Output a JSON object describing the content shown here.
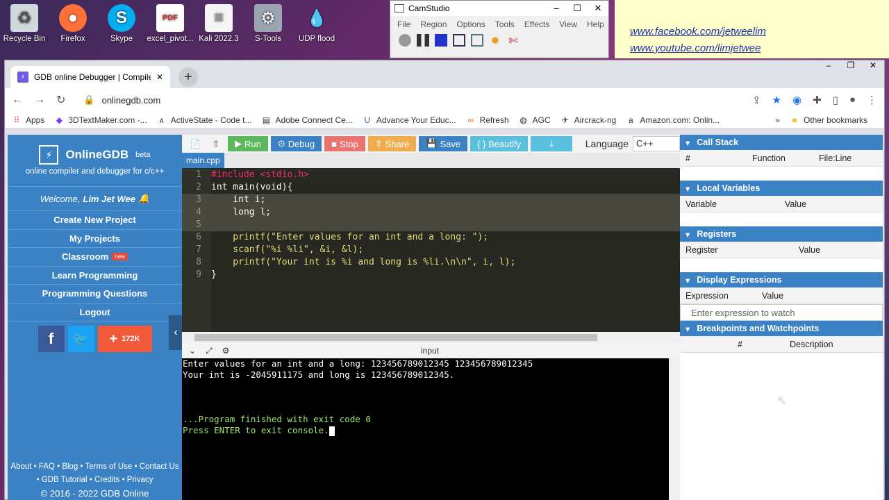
{
  "desktop": {
    "icons": [
      {
        "label": "Recycle Bin",
        "icon": "recycle-bin-icon"
      },
      {
        "label": "Firefox",
        "icon": "firefox-icon"
      },
      {
        "label": "Skype",
        "icon": "skype-icon"
      },
      {
        "label": "excel_pivot...",
        "icon": "pdf-icon"
      },
      {
        "label": "Kali 2022.3",
        "icon": "document-icon"
      },
      {
        "label": "S-Tools",
        "icon": "stools-icon"
      },
      {
        "label": "UDP flood",
        "icon": "udp-flood-icon"
      }
    ]
  },
  "camstudio": {
    "title": "CamStudio",
    "menu": [
      "File",
      "Region",
      "Options",
      "Tools",
      "Effects",
      "View",
      "Help"
    ]
  },
  "notes": {
    "links": [
      "www.facebook.com/jetweelim",
      "www.youtube.com/limjetwee"
    ]
  },
  "browser": {
    "tab_title": "GDB online Debugger | Compiler",
    "url": "onlinegdb.com",
    "bookmarks": [
      "Apps",
      "3DTextMaker.com -...",
      "ActiveState - Code t...",
      "Adobe Connect Ce...",
      "Advance Your Educ...",
      "Refresh",
      "AGC",
      "Aircrack-ng",
      "Amazon.com: Onlin..."
    ],
    "other_bookmarks": "Other bookmarks"
  },
  "sidebar": {
    "brand": "OnlineGDB",
    "brand_sup": "beta",
    "tagline": "online compiler and debugger for c/c++",
    "welcome_prefix": "Welcome,",
    "welcome_user": "Lim Jet Wee",
    "menu": [
      "Create New Project",
      "My Projects",
      "Classroom",
      "Learn Programming",
      "Programming Questions",
      "Logout"
    ],
    "classroom_badge": "new",
    "share_count": "172K",
    "footer_line1": "About • FAQ • Blog • Terms of Use • Contact Us",
    "footer_line2": "• GDB Tutorial • Credits • Privacy",
    "copyright": "© 2016 - 2022 GDB Online"
  },
  "editor_toolbar": {
    "run": "Run",
    "debug": "Debug",
    "stop": "Stop",
    "share": "Share",
    "save": "Save",
    "beautify": "{ } Beautify",
    "language_label": "Language",
    "language_value": "C++"
  },
  "file_tab": "main.cpp",
  "code_lines": [
    {
      "n": "1",
      "text": "#include <stdio.h>"
    },
    {
      "n": "2",
      "text": "int main(void){"
    },
    {
      "n": "3",
      "text": "    int i;"
    },
    {
      "n": "4",
      "text": "    long l;"
    },
    {
      "n": "5",
      "text": ""
    },
    {
      "n": "6",
      "text": "    printf(\"Enter values for an int and a long: \");"
    },
    {
      "n": "7",
      "text": "    scanf(\"%i %li\", &i, &l);"
    },
    {
      "n": "8",
      "text": "    printf(\"Your int is %i and long is %li.\\n\\n\", i, l);"
    },
    {
      "n": "9",
      "text": "}"
    }
  ],
  "io_label": "input",
  "console_lines": [
    "Enter values for an int and a long: 123456789012345 123456789012345",
    "Your int is -2045911175 and long is 123456789012345.",
    "",
    "",
    "",
    "...Program finished with exit code 0",
    "Press ENTER to exit console."
  ],
  "right_panels": {
    "call_stack": {
      "title": "Call Stack",
      "cols": [
        "#",
        "Function",
        "File:Line"
      ]
    },
    "locals": {
      "title": "Local Variables",
      "cols": [
        "Variable",
        "Value"
      ]
    },
    "registers": {
      "title": "Registers",
      "cols": [
        "Register",
        "Value"
      ]
    },
    "display": {
      "title": "Display Expressions",
      "cols": [
        "Expression",
        "Value"
      ],
      "placeholder": "Enter expression to watch"
    },
    "breakpoints": {
      "title": "Breakpoints and Watchpoints",
      "cols": [
        "#",
        "Description"
      ]
    }
  }
}
